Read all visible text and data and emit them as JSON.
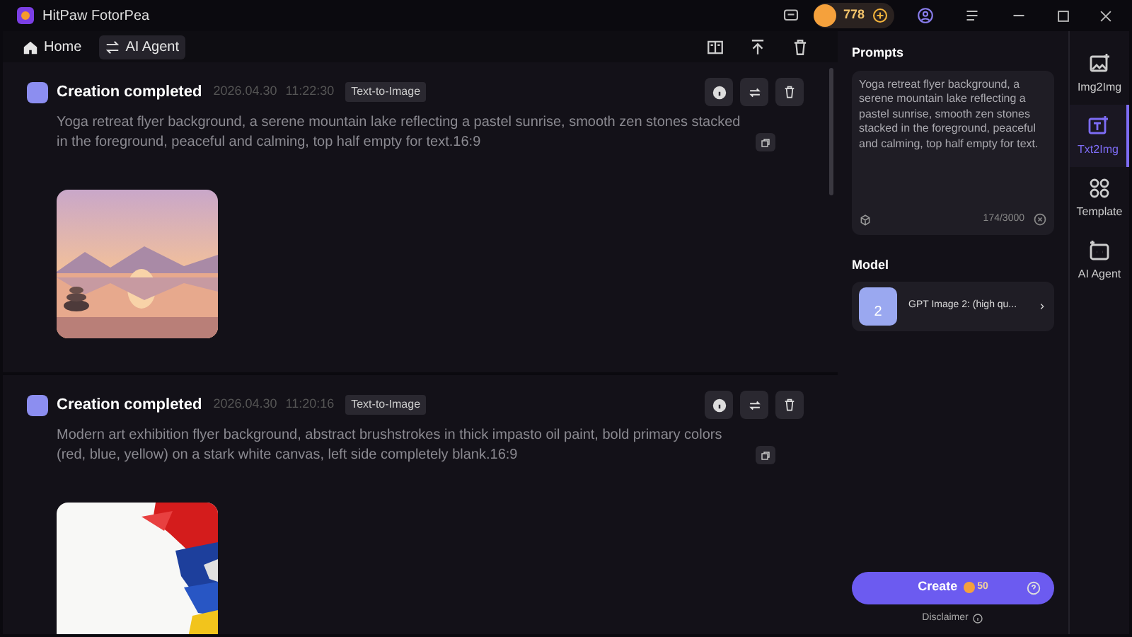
{
  "window": {
    "title": "HitPaw FotorPea",
    "credits": "778"
  },
  "toolbar": {
    "tabs": [
      {
        "label": "Home",
        "selected": false
      },
      {
        "label": "AI Agent",
        "selected": true
      }
    ]
  },
  "feed": [
    {
      "status": "Creation completed",
      "date": "2026.04.30",
      "time": "11:22:30",
      "tag": "Text-to-Image",
      "prompt": "Yoga retreat flyer background, a serene mountain lake reflecting a pastel sunrise, smooth zen stones stacked in the foreground, peaceful and calming, top half empty for text.16:9"
    },
    {
      "status": "Creation completed",
      "date": "2026.04.30",
      "time": "11:20:16",
      "tag": "Text-to-Image",
      "prompt": "Modern art exhibition flyer background, abstract brushstrokes in thick impasto oil paint, bold primary colors (red, blue, yellow) on a stark white canvas, left side completely blank.16:9"
    }
  ],
  "panel": {
    "prompts_heading": "Prompts",
    "prompt": "Yoga retreat flyer background, a serene mountain lake reflecting a pastel sunrise, smooth zen stones stacked in the foreground, peaceful and calming, top half empty for text.",
    "counter": "174/3000",
    "model_heading": "Model",
    "model_thumb": "2",
    "model": "GPT Image 2: (high qu...",
    "create": "Create",
    "cost": "50",
    "disclaimer": "Disclaimer"
  },
  "sidebar": [
    {
      "label": "Img2Img",
      "selected": false
    },
    {
      "label": "Txt2Img",
      "selected": true
    },
    {
      "label": "Template",
      "selected": false
    },
    {
      "label": "AI Agent",
      "selected": false
    }
  ]
}
